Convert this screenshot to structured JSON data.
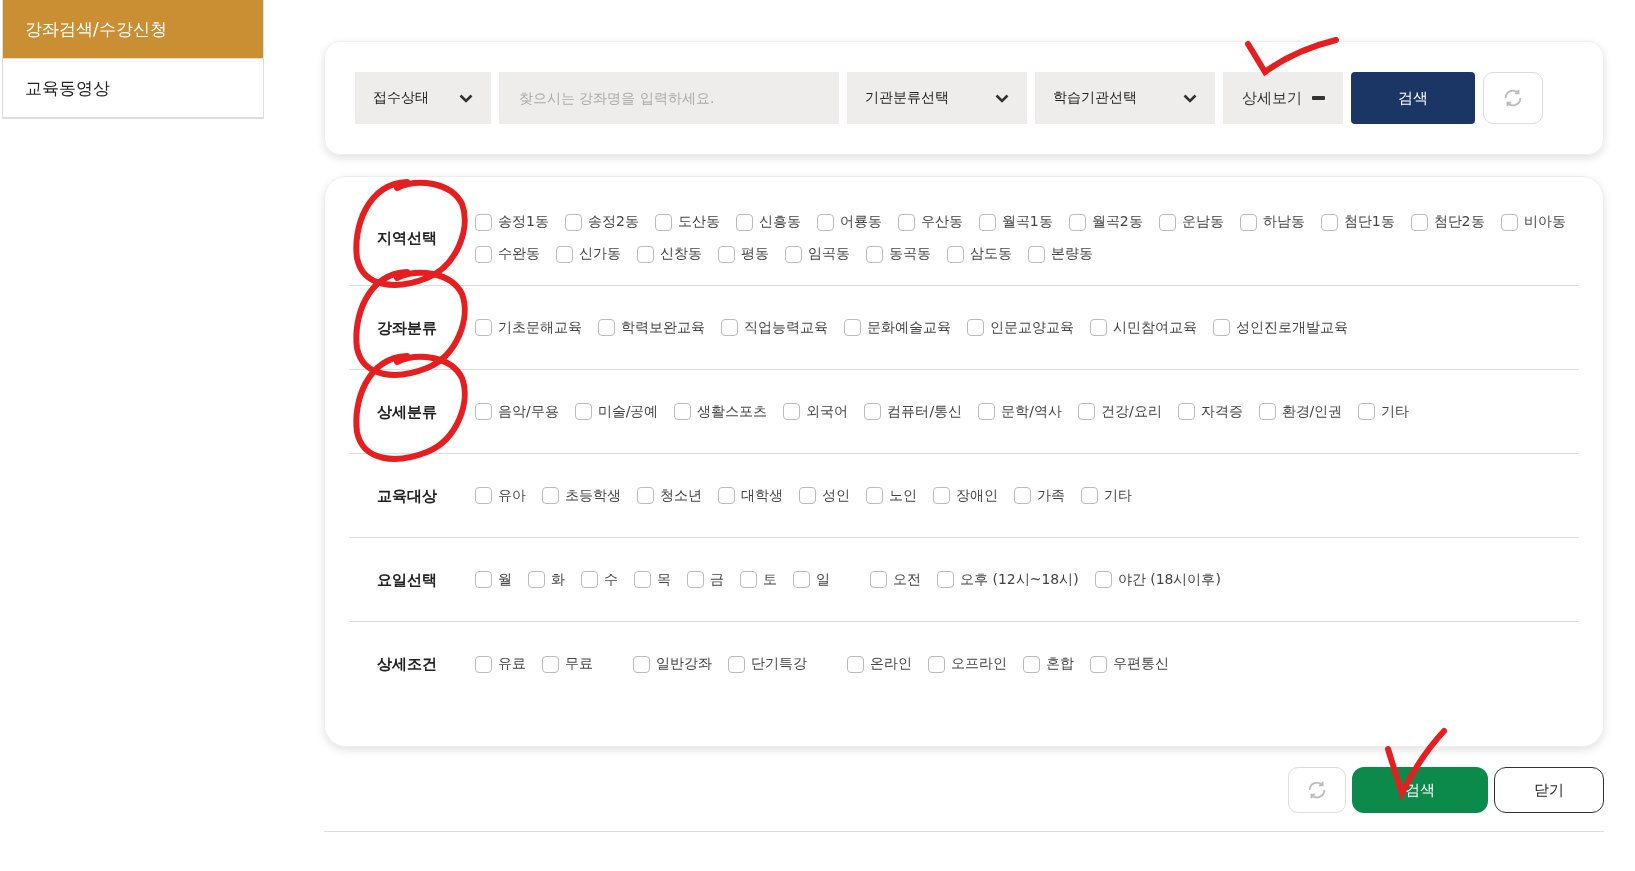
{
  "sidebar": {
    "items": [
      {
        "label": "강좌검색/수강신청",
        "selected": true
      },
      {
        "label": "교육동영상",
        "selected": false
      }
    ]
  },
  "search_bar": {
    "status_select": "접수상태",
    "keyword": {
      "placeholder": "찾으시는 강좌명을 입력하세요."
    },
    "category_select": "기관분류선택",
    "institution_select": "학습기관선택",
    "detail_toggle": {
      "label": "상세보기",
      "expanded": true,
      "check_mark": true
    },
    "search_button": "검색"
  },
  "filters": [
    {
      "label": "지역선택",
      "circled": true,
      "groups": [
        [
          {
            "label": "송정1동",
            "checked": false
          },
          {
            "label": "송정2동",
            "checked": false
          },
          {
            "label": "도산동",
            "checked": false
          },
          {
            "label": "신흥동",
            "checked": false
          },
          {
            "label": "어룡동",
            "checked": false
          },
          {
            "label": "우산동",
            "checked": false
          },
          {
            "label": "월곡1동",
            "checked": false
          },
          {
            "label": "월곡2동",
            "checked": false
          },
          {
            "label": "운남동",
            "checked": false
          },
          {
            "label": "하남동",
            "checked": false
          },
          {
            "label": "첨단1동",
            "checked": false
          },
          {
            "label": "첨단2동",
            "checked": false
          },
          {
            "label": "비아동",
            "checked": false
          },
          {
            "label": "수완동",
            "checked": false
          },
          {
            "label": "신가동",
            "checked": false
          },
          {
            "label": "신창동",
            "checked": false
          },
          {
            "label": "평동",
            "checked": false
          },
          {
            "label": "임곡동",
            "checked": false
          },
          {
            "label": "동곡동",
            "checked": false
          },
          {
            "label": "삼도동",
            "checked": false
          },
          {
            "label": "본량동",
            "checked": false
          }
        ]
      ]
    },
    {
      "label": "강좌분류",
      "circled": true,
      "groups": [
        [
          {
            "label": "기초문해교육",
            "checked": false
          },
          {
            "label": "학력보완교육",
            "checked": false
          },
          {
            "label": "직업능력교육",
            "checked": false
          },
          {
            "label": "문화예술교육",
            "checked": false
          },
          {
            "label": "인문교양교육",
            "checked": false
          },
          {
            "label": "시민참여교육",
            "checked": false
          },
          {
            "label": "성인진로개발교육",
            "checked": false
          }
        ]
      ]
    },
    {
      "label": "상세분류",
      "circled": true,
      "groups": [
        [
          {
            "label": "음악/무용",
            "checked": false
          },
          {
            "label": "미술/공예",
            "checked": false
          },
          {
            "label": "생활스포츠",
            "checked": false
          },
          {
            "label": "외국어",
            "checked": false
          },
          {
            "label": "컴퓨터/통신",
            "checked": false
          },
          {
            "label": "문학/역사",
            "checked": false
          },
          {
            "label": "건강/요리",
            "checked": false
          },
          {
            "label": "자격증",
            "checked": false
          },
          {
            "label": "환경/인권",
            "checked": false
          },
          {
            "label": "기타",
            "checked": false
          }
        ]
      ]
    },
    {
      "label": "교육대상",
      "circled": false,
      "groups": [
        [
          {
            "label": "유아",
            "checked": false
          },
          {
            "label": "초등학생",
            "checked": false
          },
          {
            "label": "청소년",
            "checked": false
          },
          {
            "label": "대학생",
            "checked": false
          },
          {
            "label": "성인",
            "checked": false
          },
          {
            "label": "노인",
            "checked": false
          },
          {
            "label": "장애인",
            "checked": false
          },
          {
            "label": "가족",
            "checked": false
          },
          {
            "label": "기타",
            "checked": false
          }
        ]
      ]
    },
    {
      "label": "요일선택",
      "circled": false,
      "groups": [
        [
          {
            "label": "월",
            "checked": false
          },
          {
            "label": "화",
            "checked": false
          },
          {
            "label": "수",
            "checked": false
          },
          {
            "label": "목",
            "checked": false
          },
          {
            "label": "금",
            "checked": false
          },
          {
            "label": "토",
            "checked": false
          },
          {
            "label": "일",
            "checked": false
          }
        ],
        [
          {
            "label": "오전",
            "checked": false
          },
          {
            "label": "오후 (12시~18시)",
            "checked": false
          },
          {
            "label": "야간 (18시이후)",
            "checked": false
          }
        ]
      ]
    },
    {
      "label": "상세조건",
      "circled": false,
      "groups": [
        [
          {
            "label": "유료",
            "checked": false
          },
          {
            "label": "무료",
            "checked": false
          }
        ],
        [
          {
            "label": "일반강좌",
            "checked": false
          },
          {
            "label": "단기특강",
            "checked": false
          }
        ],
        [
          {
            "label": "온라인",
            "checked": false
          },
          {
            "label": "오프라인",
            "checked": false
          },
          {
            "label": "혼합",
            "checked": false
          },
          {
            "label": "우편통신",
            "checked": false
          }
        ]
      ]
    }
  ],
  "footer": {
    "search_button": {
      "label": "검색",
      "check_mark": true
    },
    "close_button": "닫기"
  }
}
